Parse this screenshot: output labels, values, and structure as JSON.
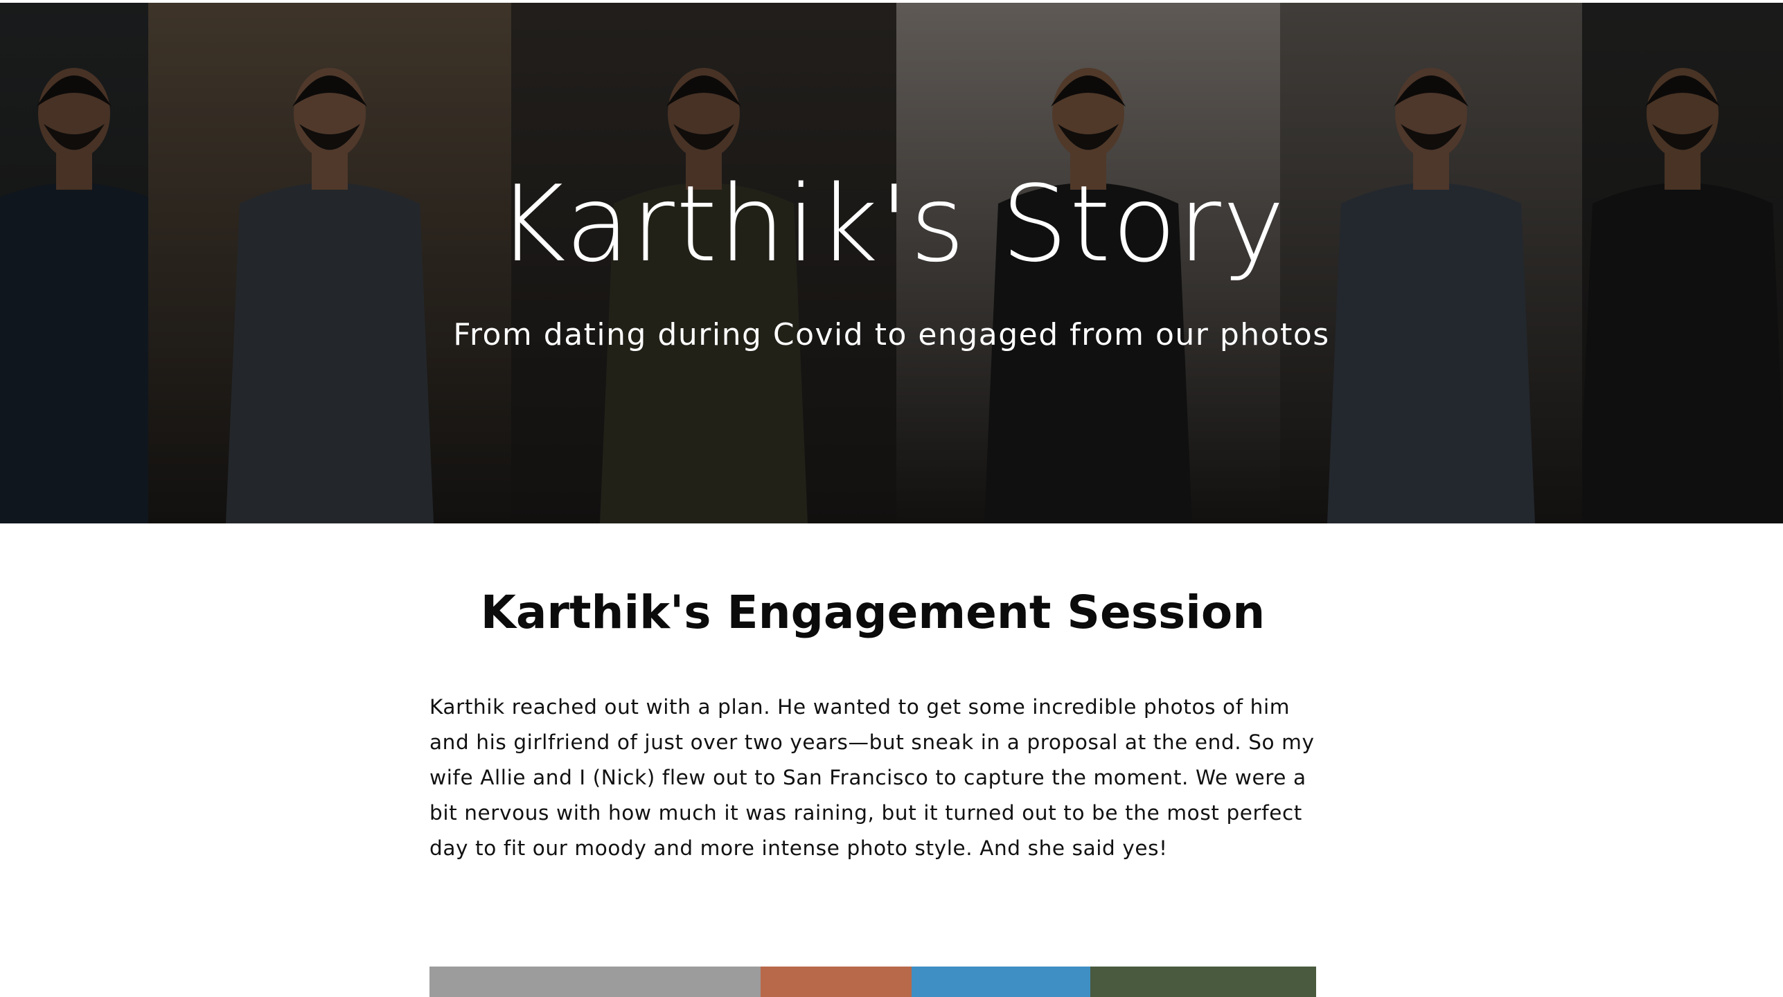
{
  "hero": {
    "title": "Karthik's Story",
    "subtitle": "From dating during Covid to engaged from our photos",
    "photos": [
      {
        "bg": "#2c2f30",
        "shirt": "#1d2733",
        "skin": "#7a5641"
      },
      {
        "bg": "#6b5a47",
        "shirt": "#3d444b",
        "skin": "#8a634b"
      },
      {
        "bg": "#3a3530",
        "shirt": "#3b3a2a",
        "skin": "#7b5640"
      },
      {
        "bg": "#a39a93",
        "shirt": "#1c1c1c",
        "skin": "#8b6247"
      },
      {
        "bg": "#6f6963",
        "shirt": "#3d4650",
        "skin": "#87604a"
      },
      {
        "bg": "#2e2e2d",
        "shirt": "#1a1a1a",
        "skin": "#7c583f"
      }
    ]
  },
  "session": {
    "title": "Karthik's Engagement Session",
    "body": "Karthik reached out with a plan. He wanted to get some incredible photos of him and his girlfriend of just over two years—but sneak in a proposal at the end. So my wife Allie and I (Nick) flew out to San Francisco to capture the moment. We were a bit nervous with how much it was raining, but it turned out to be the most perfect day to fit our moody and more intense photo style. And she said yes!"
  },
  "gallery": {
    "tiles": [
      "#9c9c9c",
      "#b8694a",
      "#3f8fc4",
      "#4a5a3e"
    ]
  }
}
